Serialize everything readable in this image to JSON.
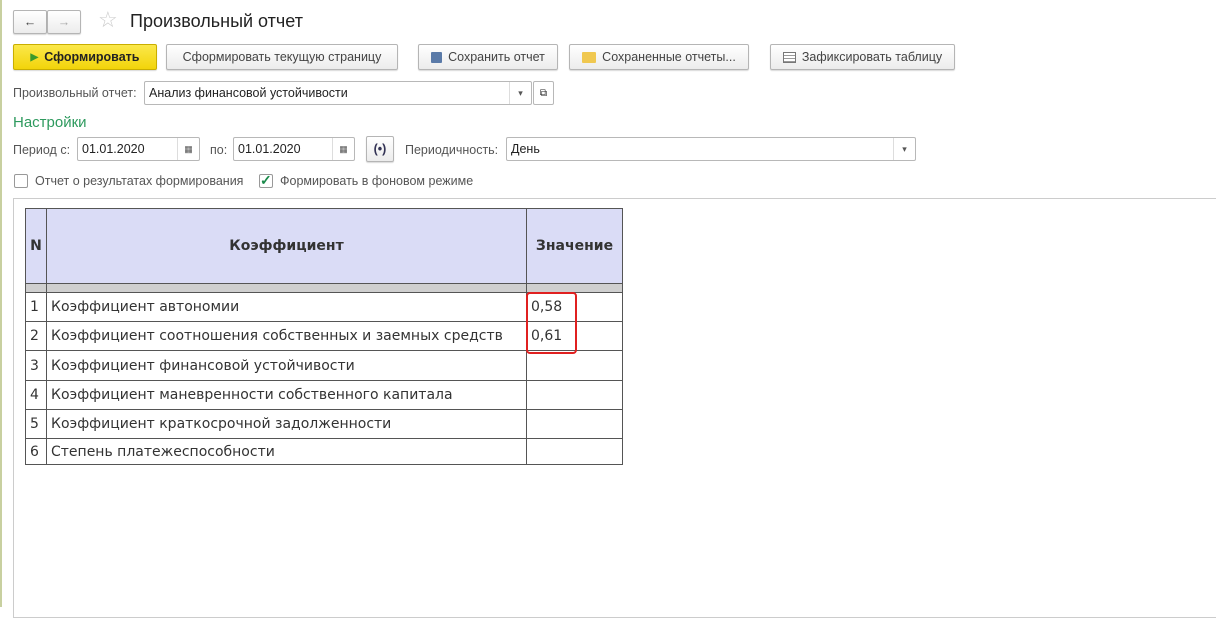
{
  "title": "Произвольный отчет",
  "toolbar": {
    "generate": "Сформировать",
    "generate_page": "Сформировать текущую страницу",
    "save": "Сохранить отчет",
    "saved": "Сохраненные отчеты...",
    "freeze": "Зафиксировать таблицу"
  },
  "report": {
    "label": "Произвольный отчет:",
    "value": "Анализ финансовой устойчивости"
  },
  "settings": {
    "title": "Настройки",
    "period_from_label": "Период с:",
    "period_from": "01.01.2020",
    "period_to_label": "по:",
    "period_to": "01.01.2020",
    "periodicity_label": "Периодичность:",
    "periodicity": "День",
    "cb_results": "Отчет о результатах формирования",
    "cb_results_checked": false,
    "cb_background": "Формировать в фоновом режиме",
    "cb_background_checked": true
  },
  "table": {
    "headers": [
      "N",
      "Коэффициент",
      "Значение"
    ],
    "rows": [
      {
        "n": "1",
        "name": "Коэффициент автономии",
        "value": "0,58"
      },
      {
        "n": "2",
        "name": "Коэффициент соотношения собственных и заемных средств",
        "value": "0,61"
      },
      {
        "n": "3",
        "name": "Коэффициент финансовой устойчивости",
        "value": ""
      },
      {
        "n": "4",
        "name": "Коэффициент маневренности собственного капитала",
        "value": ""
      },
      {
        "n": "5",
        "name": "Коэффициент краткосрочной задолженности",
        "value": ""
      },
      {
        "n": "6",
        "name": "Степень платежеспособности",
        "value": ""
      }
    ]
  },
  "colors": {
    "primary": "#f5d80f",
    "settings_title": "#2e9a5e",
    "highlight": "#e02020",
    "header_bg": "#dadcf6"
  }
}
